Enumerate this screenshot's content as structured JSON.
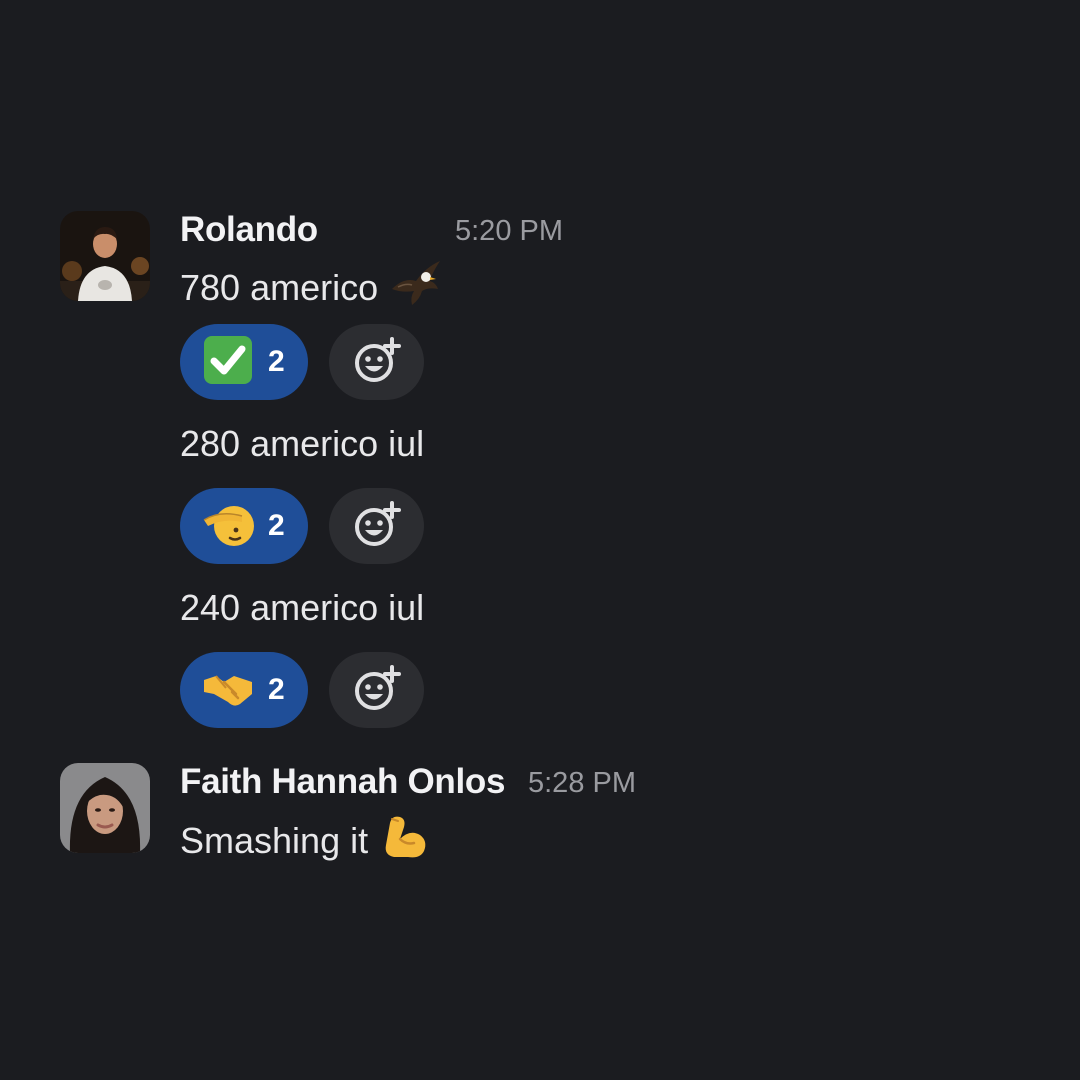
{
  "messages": [
    {
      "author": "Rolando",
      "time": "5:20 PM",
      "lines": [
        {
          "text": "780 americo",
          "emoji": "eagle-icon",
          "reaction": {
            "emoji": "check-mark-button-icon",
            "count": "2"
          }
        },
        {
          "text": "280 americo iul",
          "reaction": {
            "emoji": "saluting-face-icon",
            "count": "2"
          }
        },
        {
          "text": "240 americo iul",
          "reaction": {
            "emoji": "handshake-icon",
            "count": "2"
          }
        }
      ]
    },
    {
      "author": "Faith Hannah Onlos",
      "time": "5:28 PM",
      "lines": [
        {
          "text": "Smashing it",
          "emoji": "flexed-biceps-icon"
        }
      ]
    }
  ],
  "add_reaction_icon": "add-reaction-icon",
  "colors": {
    "background": "#1b1c20",
    "reaction_active": "#1f4e98",
    "reaction_add": "#2c2d31",
    "timestamp": "#9a9ba0"
  }
}
